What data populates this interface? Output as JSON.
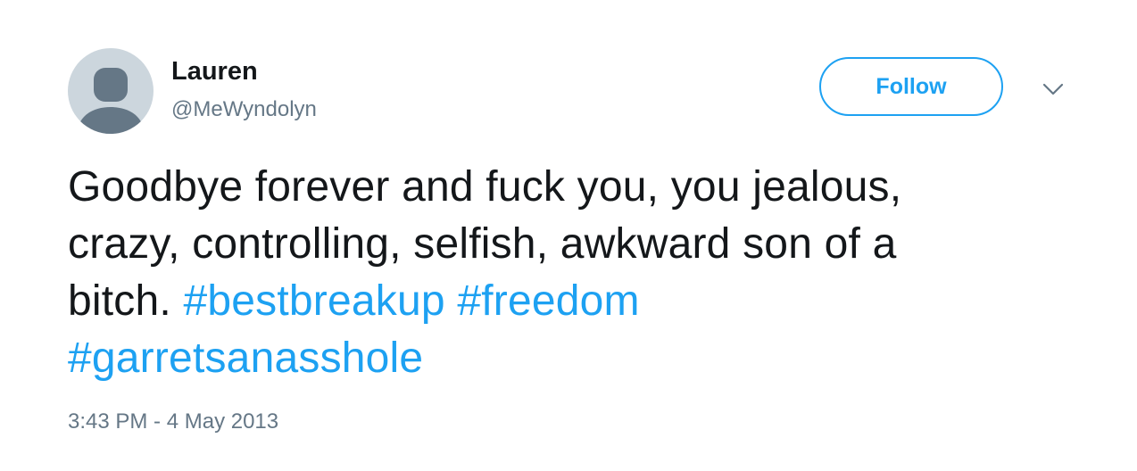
{
  "user": {
    "display_name": "Lauren",
    "handle": "@MeWyndolyn",
    "avatar_icon": "default-egg-avatar-icon"
  },
  "actions": {
    "follow_label": "Follow",
    "more_icon": "chevron-down-icon"
  },
  "tweet": {
    "text_line1": "Goodbye forever and fuck you, you jealous,",
    "text_line2": "crazy, controlling, selfish, awkward son of a",
    "text_line3": "bitch.",
    "hashtags": [
      "#bestbreakup",
      "#freedom",
      "#garretsanasshole"
    ],
    "timestamp": "3:43 PM - 4 May 2013"
  },
  "colors": {
    "link": "#1da1f2",
    "text": "#14171a",
    "muted": "#657786",
    "avatar_bg": "#ccd6dd",
    "avatar_figure": "#657786"
  }
}
